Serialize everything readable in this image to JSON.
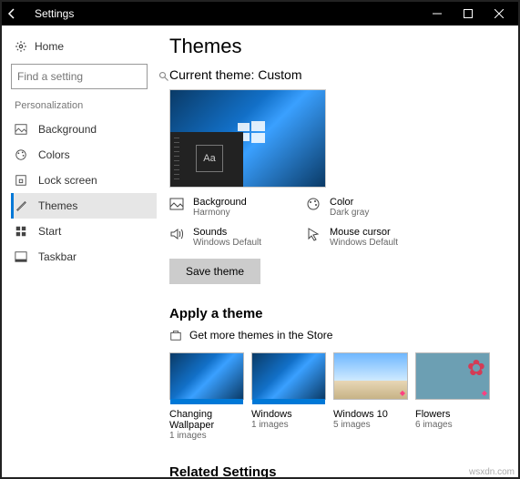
{
  "titlebar": {
    "title": "Settings"
  },
  "sidebar": {
    "home": "Home",
    "search_placeholder": "Find a setting",
    "section": "Personalization",
    "items": [
      {
        "label": "Background"
      },
      {
        "label": "Colors"
      },
      {
        "label": "Lock screen"
      },
      {
        "label": "Themes"
      },
      {
        "label": "Start"
      },
      {
        "label": "Taskbar"
      }
    ]
  },
  "page": {
    "title": "Themes",
    "current_theme_label": "Current theme: Custom",
    "preview_aa": "Aa",
    "props": {
      "background": {
        "label": "Background",
        "value": "Harmony"
      },
      "color": {
        "label": "Color",
        "value": "Dark gray"
      },
      "sounds": {
        "label": "Sounds",
        "value": "Windows Default"
      },
      "cursor": {
        "label": "Mouse cursor",
        "value": "Windows Default"
      }
    },
    "save_btn": "Save theme",
    "apply_head": "Apply a theme",
    "store_link": "Get more themes in the Store",
    "themes": [
      {
        "title": "Changing Wallpaper",
        "sub": "1 images"
      },
      {
        "title": "Windows",
        "sub": "1 images"
      },
      {
        "title": "Windows 10",
        "sub": "5 images"
      },
      {
        "title": "Flowers",
        "sub": "6 images"
      }
    ],
    "related_head": "Related Settings"
  },
  "watermark": "wsxdn.com"
}
